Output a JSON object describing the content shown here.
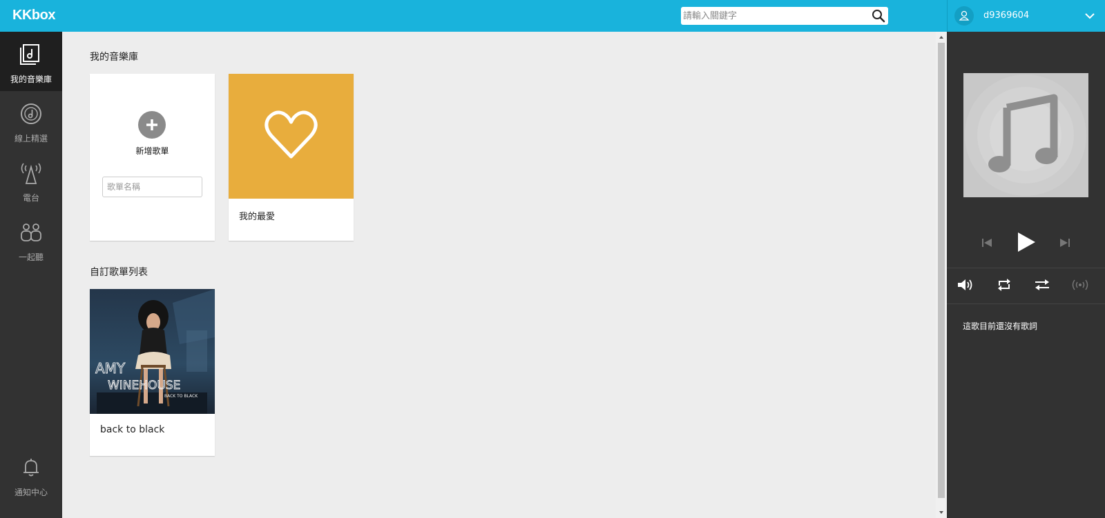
{
  "header": {
    "logo": "KKbox",
    "search_placeholder": "請輸入關鍵字",
    "username": "d9369604"
  },
  "sidebar": {
    "items": [
      {
        "label": "我的音樂庫",
        "icon": "music-library-icon",
        "active": true
      },
      {
        "label": "線上精選",
        "icon": "vinyl-disc-icon",
        "active": false
      },
      {
        "label": "電台",
        "icon": "radio-tower-icon",
        "active": false
      },
      {
        "label": "一起聽",
        "icon": "listen-together-icon",
        "active": false
      }
    ],
    "notifications_label": "通知中心"
  },
  "library": {
    "title": "我的音樂庫",
    "new_playlist_label": "新增歌單",
    "playlist_name_placeholder": "歌單名稱",
    "favorites_label": "我的最愛",
    "favorites_color": "#e8ad3d"
  },
  "custom_playlists": {
    "title": "自訂歌單列表",
    "items": [
      {
        "name": "back to black",
        "cover_text_line1": "AMY",
        "cover_text_line2": "WINEHOUSE",
        "cover_text_line3": "BACK TO BLACK"
      }
    ]
  },
  "player": {
    "lyrics_message": "這歌目前還沒有歌詞"
  },
  "colors": {
    "brand": "#19b3dc",
    "sidebar": "#323232",
    "background": "#ededed"
  }
}
